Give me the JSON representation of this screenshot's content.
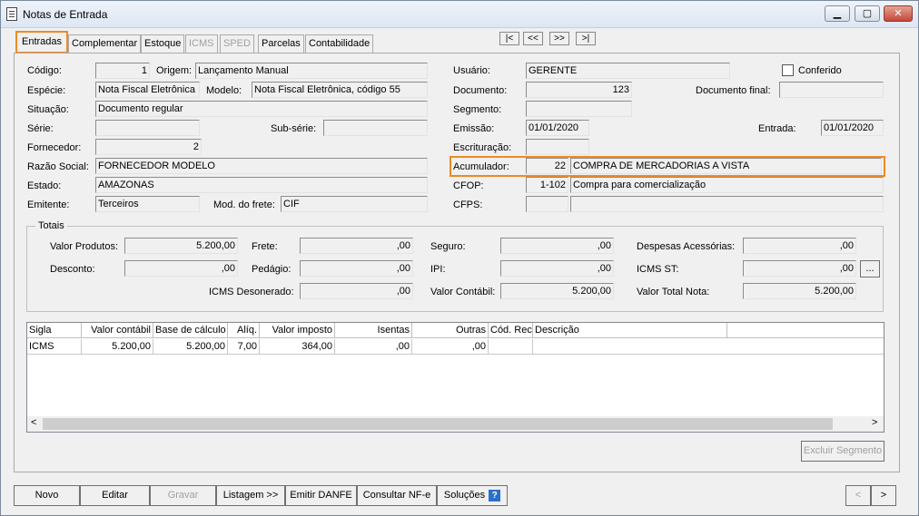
{
  "window": {
    "title": "Notas de Entrada",
    "minimize": "▁",
    "maximize": "▢",
    "close": "✕"
  },
  "tabs": [
    {
      "label": "Entradas",
      "active": true,
      "disabled": false
    },
    {
      "label": "Complementar",
      "active": false,
      "disabled": false
    },
    {
      "label": "Estoque",
      "active": false,
      "disabled": false
    },
    {
      "label": "ICMS",
      "active": false,
      "disabled": true
    },
    {
      "label": "SPED",
      "active": false,
      "disabled": true
    },
    {
      "label": "Parcelas",
      "active": false,
      "disabled": false
    },
    {
      "label": "Contabilidade",
      "active": false,
      "disabled": false
    }
  ],
  "nav": {
    "first": "|<",
    "prev": "<<",
    "next": ">>",
    "last": ">|"
  },
  "form": {
    "codigo": {
      "label": "Código:",
      "value": "1"
    },
    "origem": {
      "label": "Origem:",
      "value": "Lançamento Manual"
    },
    "especie": {
      "label": "Espécie:",
      "value": "Nota Fiscal Eletrônica"
    },
    "modelo": {
      "label": "Modelo:",
      "value": "Nota Fiscal Eletrônica, código 55"
    },
    "situacao": {
      "label": "Situação:",
      "value": "Documento regular"
    },
    "serie": {
      "label": "Série:",
      "value": ""
    },
    "subserie": {
      "label": "Sub-série:",
      "value": ""
    },
    "fornecedor": {
      "label": "Fornecedor:",
      "value": "2"
    },
    "razao_social": {
      "label": "Razão Social:",
      "value": "FORNECEDOR MODELO"
    },
    "estado": {
      "label": "Estado:",
      "value": "AMAZONAS"
    },
    "emitente": {
      "label": "Emitente:",
      "value": "Terceiros"
    },
    "mod_frete": {
      "label": "Mod. do frete:",
      "value": "CIF"
    },
    "usuario": {
      "label": "Usuário:",
      "value": "GERENTE"
    },
    "conferido": {
      "label": "Conferido",
      "checked": false
    },
    "documento": {
      "label": "Documento:",
      "value": "123"
    },
    "documento_final": {
      "label": "Documento final:",
      "value": ""
    },
    "segmento": {
      "label": "Segmento:",
      "value": ""
    },
    "emissao": {
      "label": "Emissão:",
      "value": "01/01/2020"
    },
    "entrada": {
      "label": "Entrada:",
      "value": "01/01/2020"
    },
    "escrituracao": {
      "label": "Escrituração:",
      "value": ""
    },
    "acumulador": {
      "label": "Acumulador:",
      "code": "22",
      "desc": "COMPRA DE MERCADORIAS A VISTA"
    },
    "cfop": {
      "label": "CFOP:",
      "code": "1-102",
      "desc": "Compra para comercialização"
    },
    "cfps": {
      "label": "CFPS:",
      "code": "",
      "desc": ""
    }
  },
  "totais": {
    "title": "Totais",
    "valor_produtos": {
      "label": "Valor Produtos:",
      "value": "5.200,00"
    },
    "frete": {
      "label": "Frete:",
      "value": ",00"
    },
    "seguro": {
      "label": "Seguro:",
      "value": ",00"
    },
    "despesas": {
      "label": "Despesas Acessórias:",
      "value": ",00"
    },
    "desconto": {
      "label": "Desconto:",
      "value": ",00"
    },
    "pedagio": {
      "label": "Pedágio:",
      "value": ",00"
    },
    "ipi": {
      "label": "IPI:",
      "value": ",00"
    },
    "icms_st": {
      "label": "ICMS ST:",
      "value": ",00"
    },
    "icms_desonerado": {
      "label": "ICMS Desonerado:",
      "value": ",00"
    },
    "valor_contabil": {
      "label": "Valor Contábil:",
      "value": "5.200,00"
    },
    "valor_total": {
      "label": "Valor Total Nota:",
      "value": "5.200,00"
    },
    "ellipsis": "..."
  },
  "grid": {
    "headers": [
      "Sigla",
      "Valor contábil",
      "Base de cálculo",
      "Alíq.",
      "Valor imposto",
      "Isentas",
      "Outras",
      "Cód. Rec.",
      "Descrição"
    ],
    "rows": [
      [
        "ICMS",
        "5.200,00",
        "5.200,00",
        "7,00",
        "364,00",
        ",00",
        ",00",
        "",
        ""
      ]
    ],
    "scroll_left": "<",
    "scroll_right": ">"
  },
  "excluir_segmento": "Excluir Segmento",
  "buttons": {
    "novo": "Novo",
    "editar": "Editar",
    "gravar": "Gravar",
    "listagem": "Listagem >>",
    "emitir_danfe": "Emitir DANFE",
    "consultar_nfe": "Consultar NF-e",
    "solucoes": "Soluções",
    "help": "?",
    "prev": "<",
    "next": ">"
  }
}
